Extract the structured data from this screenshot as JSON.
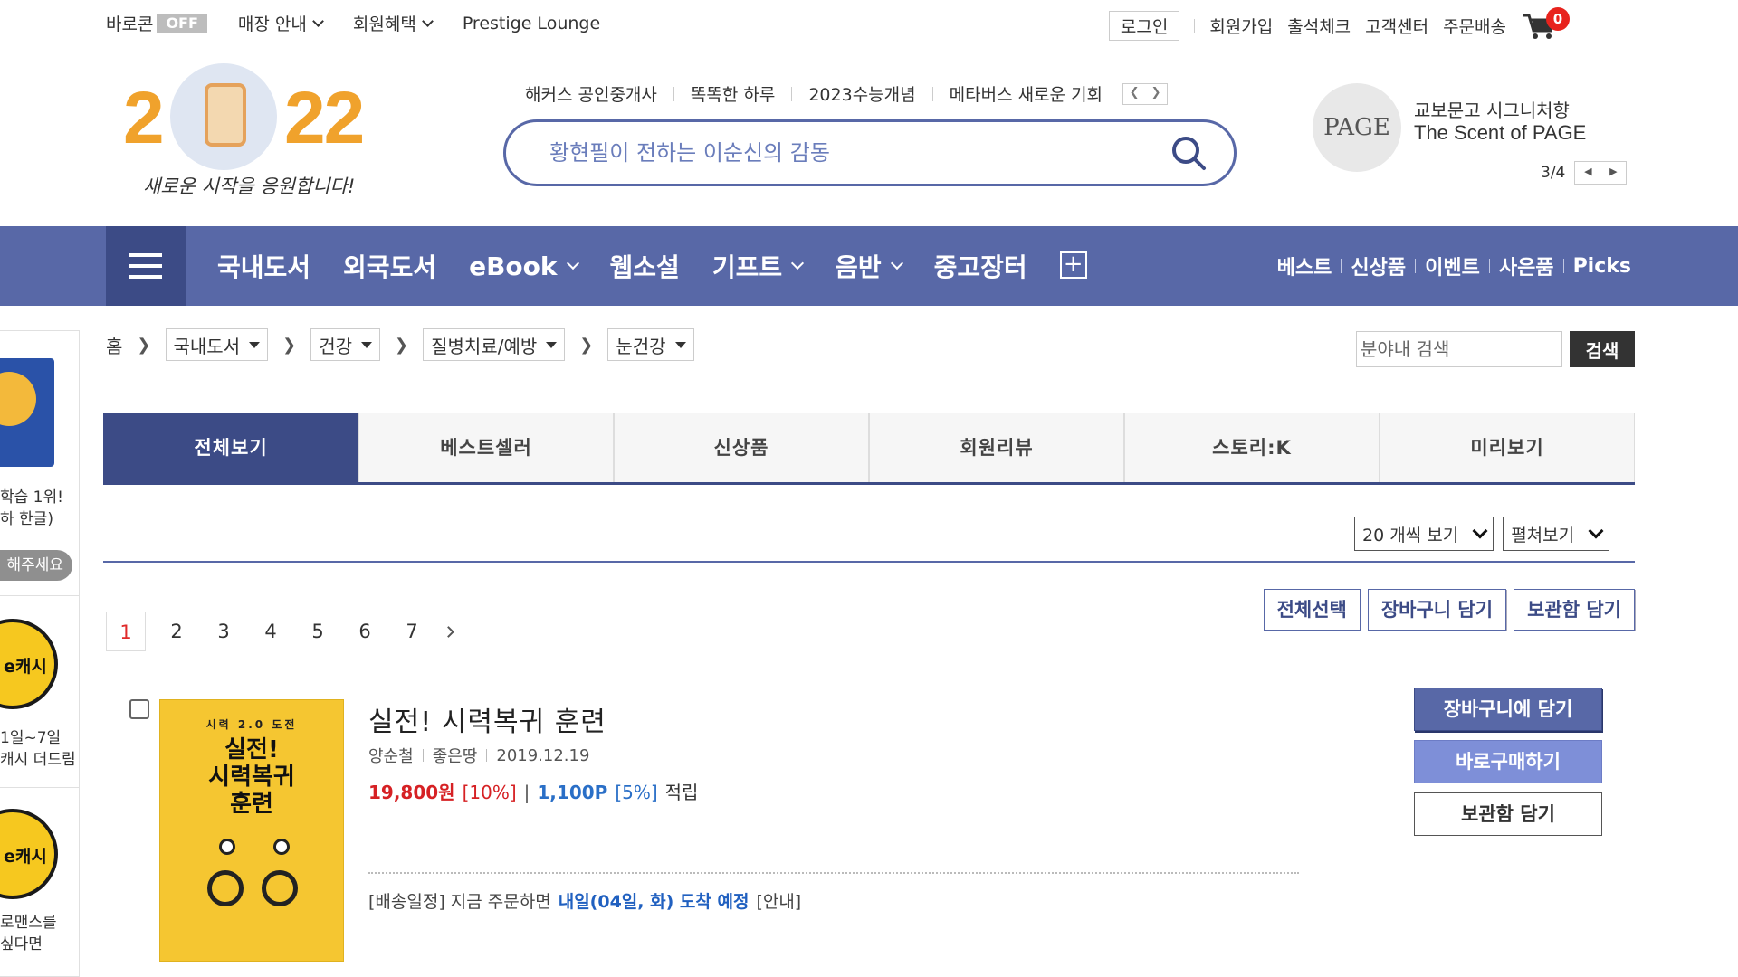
{
  "util": {
    "baro_label": "바로콘",
    "baro_state": "OFF",
    "store_info": "매장 안내",
    "member_benefit": "회원혜택",
    "prestige": "Prestige Lounge",
    "login": "로그인",
    "join": "회원가입",
    "attendance": "출석체크",
    "customer_center": "고객센터",
    "order_delivery": "주문배송",
    "cart_count": "0"
  },
  "logo": {
    "year_left": "2",
    "year_right": "22",
    "subtitle": "새로운 시작을 응원합니다!"
  },
  "search": {
    "quick_links": [
      "해커스 공인중개사",
      "똑똑한 하루",
      "2023수능개념",
      "메타버스 새로운 기회"
    ],
    "placeholder": "황현필이 전하는 이순신의 감동"
  },
  "promo": {
    "logo_text": "PAGE",
    "line1": "교보문고 시그니처향",
    "line2": "The Scent of PAGE",
    "page": "3/4"
  },
  "nav": {
    "items": [
      {
        "label": "국내도서",
        "caret": false
      },
      {
        "label": "외국도서",
        "caret": false
      },
      {
        "label": "eBook",
        "caret": true
      },
      {
        "label": "웹소설",
        "caret": false
      },
      {
        "label": "기프트",
        "caret": true
      },
      {
        "label": "음반",
        "caret": true
      },
      {
        "label": "중고장터",
        "caret": false
      }
    ],
    "right": [
      "베스트",
      "신상품",
      "이벤트",
      "사은품",
      "Picks"
    ]
  },
  "side": {
    "text1": "학습 1위!",
    "text2": "하 한글)",
    "button": "해주세요",
    "coin1": "e캐시",
    "text3": "1일~7일",
    "text4": "캐시 더드림",
    "coin2": "e캐시",
    "text5": "로맨스를",
    "text6": "싶다면"
  },
  "breadcrumb": {
    "home": "홈",
    "levels": [
      "국내도서",
      "건강",
      "질병치료/예방",
      "눈건강"
    ],
    "search_placeholder": "분야내 검색",
    "search_button": "검색"
  },
  "tabs": [
    "전체보기",
    "베스트셀러",
    "신상품",
    "회원리뷰",
    "스토리:K",
    "미리보기"
  ],
  "view": {
    "per_page": "20 개씩 보기",
    "mode": "펼쳐보기"
  },
  "actions": [
    "전체선택",
    "장바구니 담기",
    "보관함 담기"
  ],
  "pagination": [
    "1",
    "2",
    "3",
    "4",
    "5",
    "6",
    "7"
  ],
  "product": {
    "cover_series": "시력 2.0 도전",
    "cover_title_1": "실전!",
    "cover_title_2": "시력복귀",
    "cover_title_3": "훈련",
    "title": "실전! 시력복귀 훈련",
    "author": "양순철",
    "publisher": "좋은땅",
    "date": "2019.12.19",
    "price": "19,800원",
    "discount": "[10%]",
    "points": "1,100P",
    "points_rate": "[5%]",
    "points_label": "적립",
    "ship_prefix": "[배송일정] 지금 주문하면",
    "ship_highlight": "내일(04일, 화) 도착 예정",
    "ship_suffix": "[안내]",
    "btn_cart": "장바구니에 담기",
    "btn_buy": "바로구매하기",
    "btn_keep": "보관함 담기"
  }
}
